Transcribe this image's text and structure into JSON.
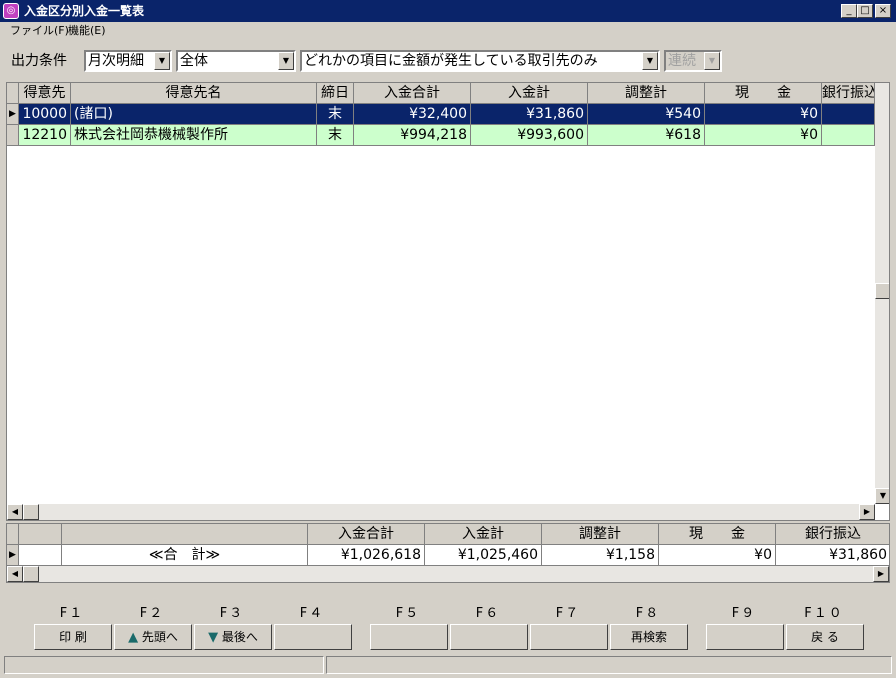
{
  "window": {
    "title": "入金区分別入金一覧表",
    "app_icon": "app-icon"
  },
  "menu": [
    {
      "label": "ファイル(F)"
    },
    {
      "label": "機能(E)"
    }
  ],
  "conditions": {
    "label": "出力条件",
    "period": "月次明細",
    "scope": "全体",
    "filter": "どれかの項目に金額が発生している取引先のみ",
    "mode": "連続"
  },
  "grid": {
    "columns": [
      "得意先",
      "得意先名",
      "締日",
      "入金合計",
      "入金計",
      "調整計",
      "現　　金",
      "銀行振込"
    ],
    "rows": [
      {
        "code": "10000",
        "name": "(諸口)",
        "close": "末",
        "total": "¥32,400",
        "paid": "¥31,860",
        "adjust": "¥540",
        "cash": "¥0",
        "bank": ""
      },
      {
        "code": "12210",
        "name": "株式会社岡恭機械製作所",
        "close": "末",
        "total": "¥994,218",
        "paid": "¥993,600",
        "adjust": "¥618",
        "cash": "¥0",
        "bank": ""
      }
    ]
  },
  "summary": {
    "columns": [
      "入金合計",
      "入金計",
      "調整計",
      "現　　金",
      "銀行振込"
    ],
    "label": "≪合　計≫",
    "values": [
      "¥1,026,618",
      "¥1,025,460",
      "¥1,158",
      "¥0",
      "¥31,860"
    ]
  },
  "fkeys": [
    {
      "key": "F１",
      "label": "印 刷",
      "icon": ""
    },
    {
      "key": "F２",
      "label": "先頭へ",
      "icon": "arrow-up-icon"
    },
    {
      "key": "F３",
      "label": "最後へ",
      "icon": "arrow-down-icon"
    },
    {
      "key": "F４",
      "label": ""
    },
    {
      "key": "F５",
      "label": ""
    },
    {
      "key": "F６",
      "label": ""
    },
    {
      "key": "F７",
      "label": ""
    },
    {
      "key": "F８",
      "label": "再検索"
    },
    {
      "key": "F９",
      "label": ""
    },
    {
      "key": "F１０",
      "label": "戻 る"
    }
  ],
  "colors": {
    "title": "#0a246a",
    "selected_row": "#0a246a",
    "highlight_row": "#ccffcc",
    "face": "#d4d0c8"
  }
}
